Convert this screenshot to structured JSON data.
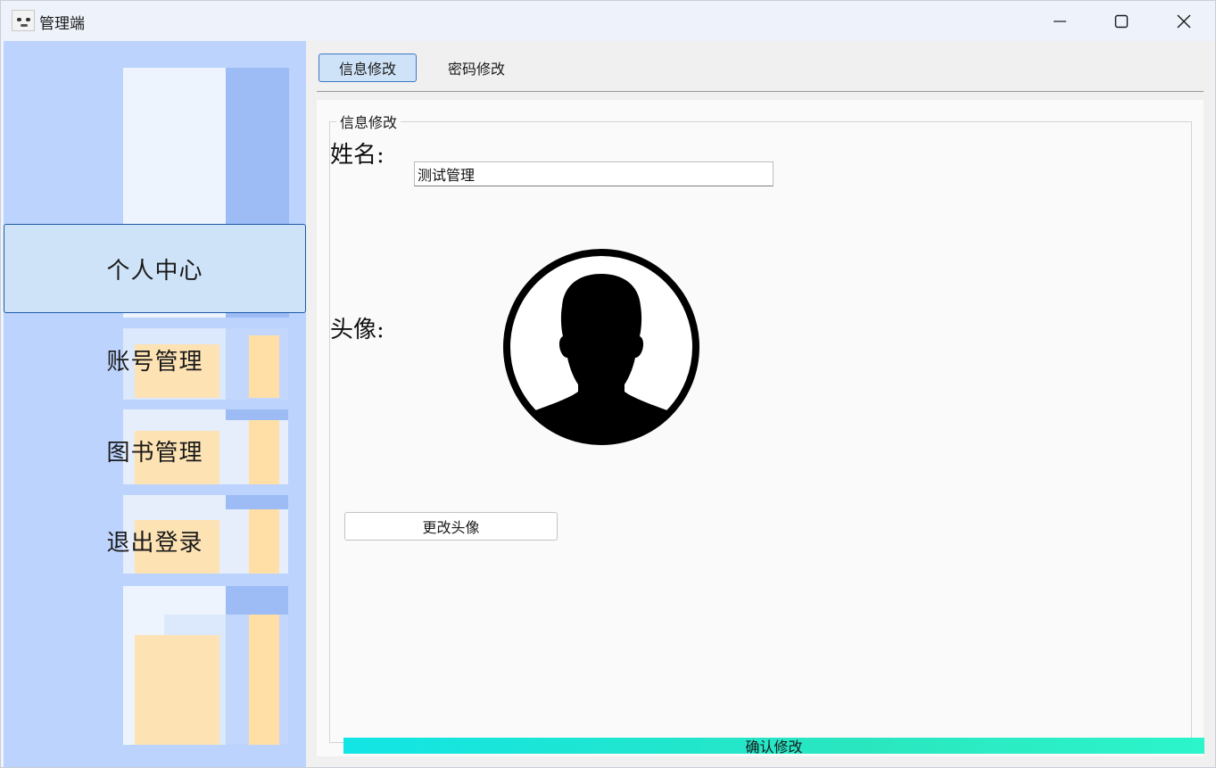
{
  "window": {
    "title": "管理端",
    "controls": [
      "minimize",
      "maximize",
      "close"
    ]
  },
  "sidebar": {
    "items": [
      {
        "label": "个人中心",
        "active": true
      },
      {
        "label": "账号管理",
        "active": false
      },
      {
        "label": "图书管理",
        "active": false
      },
      {
        "label": "退出登录",
        "active": false
      }
    ]
  },
  "tabs": [
    {
      "label": "信息修改",
      "active": true
    },
    {
      "label": "密码修改",
      "active": false
    }
  ],
  "form": {
    "group_title": "信息修改",
    "name_label": "姓名:",
    "name_value": "测试管理",
    "avatar_label": "头像:",
    "change_avatar_button": "更改头像",
    "confirm_button": "确认修改"
  },
  "colors": {
    "sidebar_bg": "#bcd3fd",
    "active_bg": "#cfe3f8",
    "active_border": "#1b5aa8",
    "confirm_gradient_start": "#12e5e5",
    "confirm_gradient_end": "#2cf5cb"
  },
  "icons": {
    "app": "app-logo-icon",
    "avatar": "user-silhouette-icon"
  }
}
